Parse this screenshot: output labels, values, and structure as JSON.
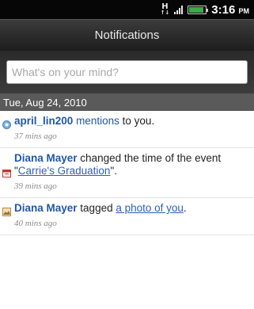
{
  "status_bar": {
    "network_type": "H",
    "time": "3:16",
    "ampm": "PM",
    "battery_level": 0.9
  },
  "header": {
    "title": "Notifications"
  },
  "composer": {
    "placeholder": "What's on your mind?"
  },
  "date_header": "Tue, Aug 24, 2010",
  "notifications": [
    {
      "name": "april_lin200",
      "verb": "mentions",
      "rest": " to you.",
      "time": "37 mins ago",
      "icon": "mention-icon"
    },
    {
      "name": "Diana Mayer",
      "text1": " changed the time of the event \"",
      "link": "Carrie's Graduation",
      "text2": "\".",
      "time": "39 mins ago",
      "icon": "calendar-icon"
    },
    {
      "name": "Diana Mayer",
      "text1": " tagged ",
      "link": "a photo of you",
      "text2": ".",
      "time": "40 mins ago",
      "icon": "photo-icon"
    }
  ]
}
